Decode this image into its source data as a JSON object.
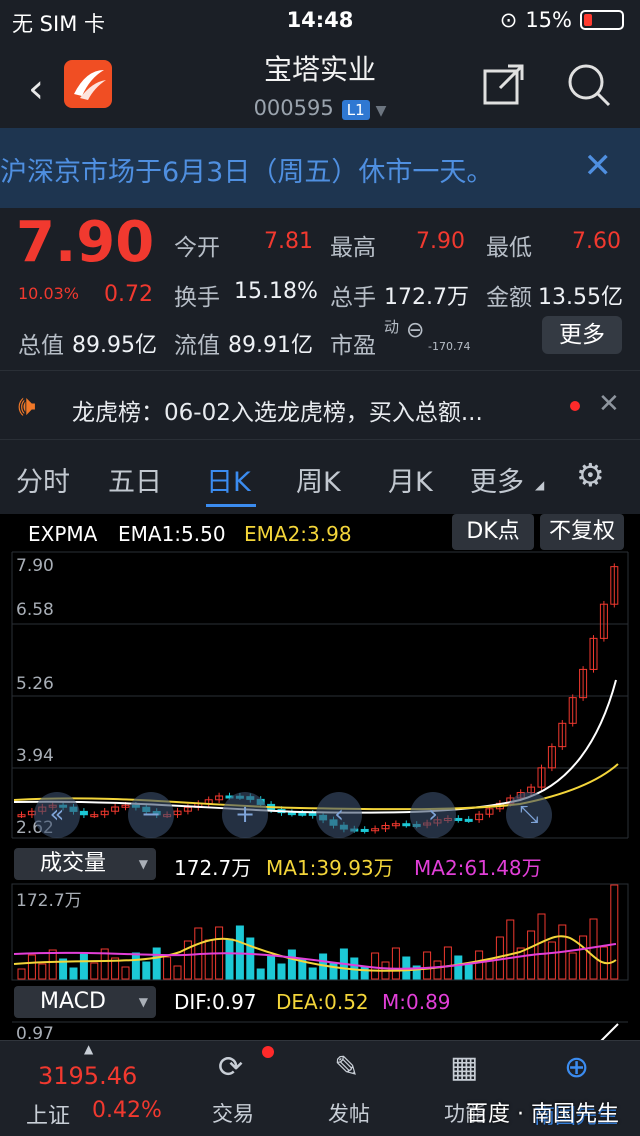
{
  "status": {
    "carrier": "无 SIM 卡",
    "time": "14:48",
    "battery": "15%"
  },
  "header": {
    "title": "宝塔实业",
    "code": "000595",
    "level": "L1"
  },
  "banner": {
    "text": "沪深京市场于6月3日（周五）休市一天。"
  },
  "quote": {
    "price": "7.90",
    "change_pct": "10.03%",
    "change": "0.72",
    "open_label": "今开",
    "open": "7.81",
    "high_label": "最高",
    "high": "7.90",
    "low_label": "最低",
    "low": "7.60",
    "turnover_label": "换手",
    "turnover": "15.18%",
    "volume_label": "总手",
    "volume": "172.7万",
    "amount_label": "金额",
    "amount": "13.55亿",
    "mktcap_label": "总值",
    "mktcap": "89.95亿",
    "float_label": "流值",
    "float": "89.91亿",
    "pe_label": "市盈",
    "pe_sup": "动",
    "pe": "-170.74",
    "more": "更多"
  },
  "news": {
    "text": "龙虎榜：06-02入选龙虎榜，买入总额..."
  },
  "tabs": [
    "分时",
    "五日",
    "日K",
    "周K",
    "月K",
    "更多"
  ],
  "active_tab": "日K",
  "kline": {
    "indicator": "EXPMA",
    "ema1": "EMA1:5.50",
    "ema2": "EMA2:3.98",
    "dk_btn": "DK点",
    "adjust_btn": "不复权",
    "y_labels": [
      "7.90",
      "6.58",
      "5.26",
      "3.94",
      "2.62"
    ]
  },
  "volume": {
    "selector": "成交量",
    "value": "172.7万",
    "ma1": "MA1:39.93万",
    "ma2": "MA2:61.48万",
    "y_label": "172.7万"
  },
  "macd": {
    "selector": "MACD",
    "dif": "DIF:0.97",
    "dea": "DEA:0.52",
    "m": "M:0.89",
    "y_label": "0.97"
  },
  "bottom_nav": {
    "index_value": "3195.46",
    "index_name": "上证",
    "index_pct": "0.42%",
    "items": [
      "交易",
      "发帖",
      "功能",
      "南国先生"
    ],
    "watermark": "百度 · 南国先生"
  },
  "colors": {
    "up": "#f1392f",
    "down": "#1cc9d6",
    "accent": "#3b8cf0",
    "ema1": "#ffffff",
    "ema2": "#f3d53a",
    "ma2": "#e23fd8"
  }
}
